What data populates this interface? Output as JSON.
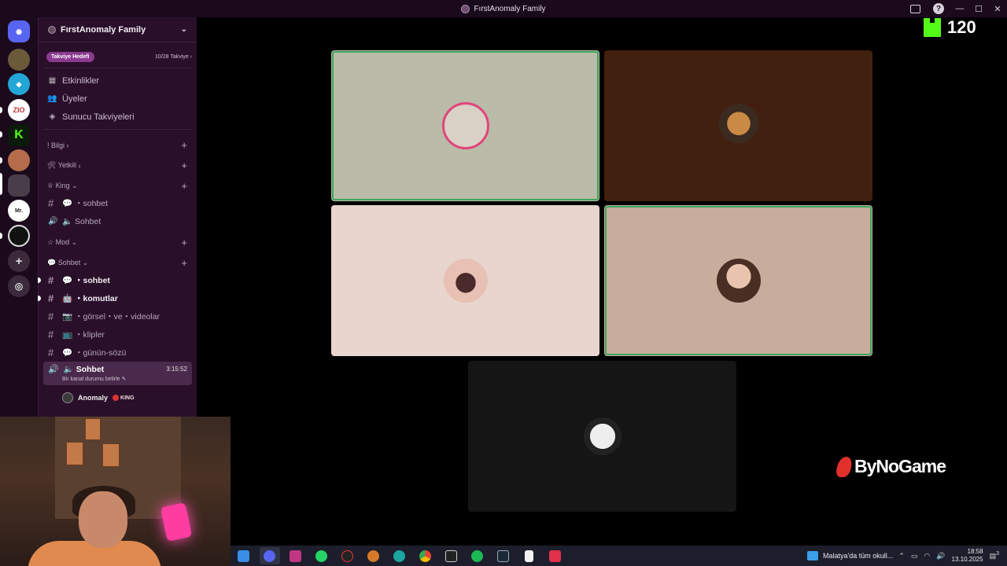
{
  "window": {
    "title": "FırstAnomaly Family"
  },
  "server": {
    "name": "FırstAnomaly Family",
    "boost_tag": "Takviye Hedefi",
    "boost_count": "10/28 Takviye"
  },
  "nav": [
    {
      "label": "Etkinlikler",
      "icon": "calendar-icon"
    },
    {
      "label": "Üyeler",
      "icon": "members-icon"
    },
    {
      "label": "Sunucu Takviyeleri",
      "icon": "boost-icon"
    }
  ],
  "categories": {
    "bilgi": "! Bilgi",
    "yetkili": "🛠 Yetkili",
    "king": "♕ King",
    "mod": "☆ Mod",
    "sohbet": "💬 Sohbet"
  },
  "king_channels": {
    "text": "💬 ・sohbet",
    "voice": "🔈 Sohbet"
  },
  "sohbet_channels": [
    {
      "label": "💬 ・sohbet",
      "unread": true
    },
    {
      "label": "🤖 ・komutlar",
      "unread": true
    },
    {
      "label": "📷 ・görsel・ve・videolar",
      "unread": false
    },
    {
      "label": "📺 ・klipler",
      "unread": false
    },
    {
      "label": "💬 ・günün-sözü",
      "unread": false
    }
  ],
  "active_voice": {
    "label": "🔈 Sohbet",
    "time": "3:15:52",
    "status": "Bir kanal durumu belirle ✎"
  },
  "member": {
    "name": "Anomaly",
    "role": "KING"
  },
  "overlay": {
    "kick_count": "120",
    "sponsor": "ByNoGame"
  },
  "taskbar": {
    "news": "Malatya'da tüm okull...",
    "time": "18:58",
    "date": "13.10.2025",
    "notif_count": "3"
  },
  "colors": {
    "speaking_ring": "#3ba55c",
    "sidebar_bg": "#2a0f2b",
    "rail_bg": "#1a0a1c",
    "kick_green": "#53fc18",
    "sponsor_red": "#e0302a"
  }
}
